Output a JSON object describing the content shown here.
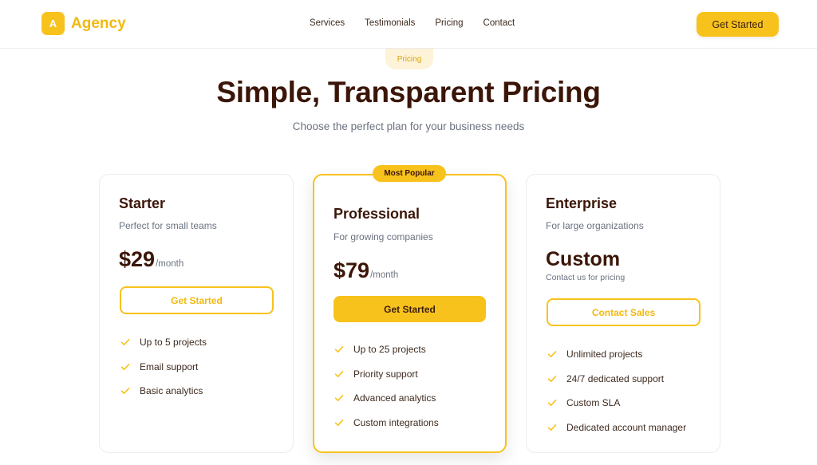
{
  "header": {
    "logo_letter": "A",
    "brand": "Agency",
    "nav": [
      "Services",
      "Testimonials",
      "Pricing",
      "Contact"
    ],
    "cta": "Get Started"
  },
  "hero": {
    "badge": "Pricing",
    "title": "Simple, Transparent Pricing",
    "subtitle": "Choose the perfect plan for your business needs"
  },
  "plans": [
    {
      "name": "Starter",
      "description": "Perfect for small teams",
      "price": "$29",
      "period": "/month",
      "button": "Get Started",
      "features": [
        "Up to 5 projects",
        "Email support",
        "Basic analytics"
      ]
    },
    {
      "badge": "Most Popular",
      "name": "Professional",
      "description": "For growing companies",
      "price": "$79",
      "period": "/month",
      "button": "Get Started",
      "features": [
        "Up to 25 projects",
        "Priority support",
        "Advanced analytics",
        "Custom integrations"
      ]
    },
    {
      "name": "Enterprise",
      "description": "For large organizations",
      "price": "Custom",
      "price_note": "Contact us for pricing",
      "button": "Contact Sales",
      "features": [
        "Unlimited projects",
        "24/7 dedicated support",
        "Custom SLA",
        "Dedicated account manager"
      ]
    }
  ],
  "colors": {
    "accent": "#f8c21c",
    "heading": "#3b1608",
    "muted": "#6b7280"
  },
  "icons": {
    "feature": "check-icon"
  }
}
